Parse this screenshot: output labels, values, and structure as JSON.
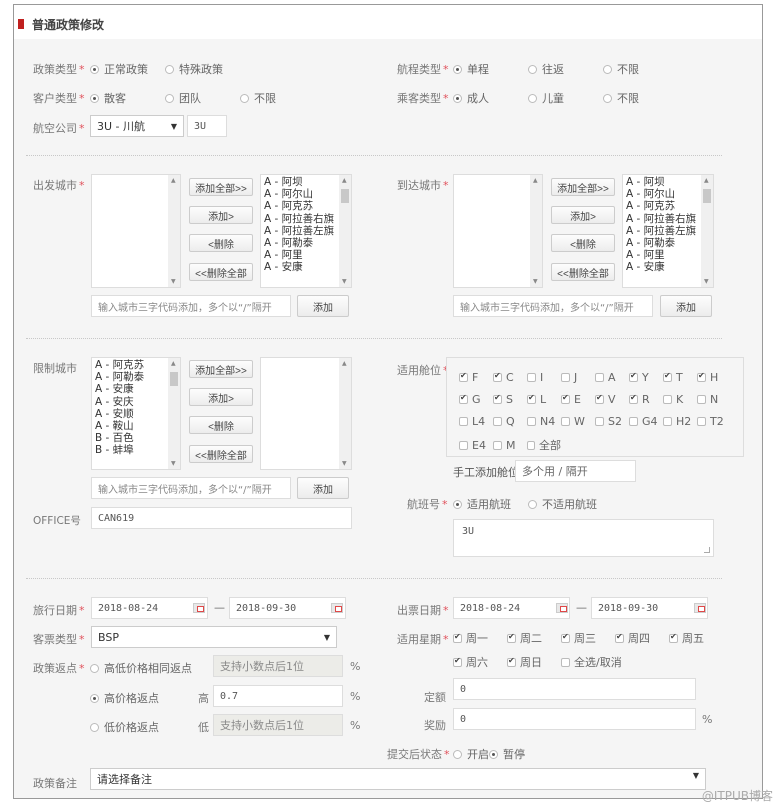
{
  "header": {
    "title": "普通政策修改",
    "accent_color": "#c0201f"
  },
  "policy_type": {
    "label": "政策类型",
    "options": [
      {
        "label": "正常政策",
        "selected": true
      },
      {
        "label": "特殊政策",
        "selected": false
      }
    ]
  },
  "route_type": {
    "label": "航程类型",
    "options": [
      {
        "label": "单程",
        "selected": true
      },
      {
        "label": "往返",
        "selected": false
      },
      {
        "label": "不限",
        "selected": false
      }
    ]
  },
  "customer_type": {
    "label": "客户类型",
    "options": [
      {
        "label": "散客",
        "selected": true
      },
      {
        "label": "团队",
        "selected": false
      },
      {
        "label": "不限",
        "selected": false
      }
    ]
  },
  "passenger_type": {
    "label": "乘客类型",
    "options": [
      {
        "label": "成人",
        "selected": true
      },
      {
        "label": "儿童",
        "selected": false
      },
      {
        "label": "不限",
        "selected": false
      }
    ]
  },
  "airline": {
    "label": "航空公司",
    "selected": "3U - 川航",
    "code": "3U"
  },
  "transfer_buttons": {
    "add_all": "添加全部>>",
    "add": "添加>",
    "remove": "<删除",
    "remove_all": "<<删除全部"
  },
  "city_input": {
    "placeholder": "输入城市三字代码添加，多个以“/”隔开",
    "add_label": "添加"
  },
  "departure_city": {
    "label": "出发城市",
    "selected_items": [],
    "available_items": [
      "A - 阿坝",
      "A - 阿尔山",
      "A - 阿克苏",
      "A - 阿拉善右旗",
      "A - 阿拉善左旗",
      "A - 阿勒泰",
      "A - 阿里",
      "A - 安康"
    ]
  },
  "arrival_city": {
    "label": "到达城市",
    "selected_items": [],
    "available_items": [
      "A - 阿坝",
      "A - 阿尔山",
      "A - 阿克苏",
      "A - 阿拉善右旗",
      "A - 阿拉善左旗",
      "A - 阿勒泰",
      "A - 阿里",
      "A - 安康"
    ]
  },
  "restricted_city": {
    "label": "限制城市",
    "available_items": [
      "A - 阿克苏",
      "A - 阿勒泰",
      "A - 安康",
      "A - 安庆",
      "A - 安顺",
      "A - 鞍山",
      "B - 百色",
      "B - 蚌埠"
    ],
    "selected_items": []
  },
  "office": {
    "label": "OFFICE号",
    "value": "CAN619"
  },
  "cabins": {
    "label": "适用舱位",
    "items": [
      {
        "code": "F",
        "checked": true
      },
      {
        "code": "C",
        "checked": true
      },
      {
        "code": "I",
        "checked": false
      },
      {
        "code": "J",
        "checked": false
      },
      {
        "code": "A",
        "checked": false
      },
      {
        "code": "Y",
        "checked": true
      },
      {
        "code": "T",
        "checked": true
      },
      {
        "code": "H",
        "checked": true
      },
      {
        "code": "G",
        "checked": true
      },
      {
        "code": "S",
        "checked": true
      },
      {
        "code": "L",
        "checked": true
      },
      {
        "code": "E",
        "checked": true
      },
      {
        "code": "V",
        "checked": true
      },
      {
        "code": "R",
        "checked": true
      },
      {
        "code": "K",
        "checked": false
      },
      {
        "code": "N",
        "checked": false
      },
      {
        "code": "L4",
        "checked": false
      },
      {
        "code": "Q",
        "checked": false
      },
      {
        "code": "N4",
        "checked": false
      },
      {
        "code": "W",
        "checked": false
      },
      {
        "code": "S2",
        "checked": false
      },
      {
        "code": "G4",
        "checked": false
      },
      {
        "code": "H2",
        "checked": false
      },
      {
        "code": "T2",
        "checked": false
      },
      {
        "code": "E4",
        "checked": false
      },
      {
        "code": "M",
        "checked": false
      },
      {
        "code": "全部",
        "checked": false
      }
    ],
    "manual_label": "手工添加舱位",
    "manual_placeholder": "多个用 / 隔开"
  },
  "flight_no": {
    "label": "航班号",
    "options": [
      {
        "label": "适用航班",
        "selected": true
      },
      {
        "label": "不适用航班",
        "selected": false
      }
    ],
    "value": "3U"
  },
  "travel_date": {
    "label": "旅行日期",
    "from": "2018-08-24",
    "to": "2018-09-30",
    "separator": "—"
  },
  "ticket_date": {
    "label": "出票日期",
    "from": "2018-08-24",
    "to": "2018-09-30",
    "separator": "—"
  },
  "ticket_type": {
    "label": "客票类型",
    "selected": "BSP"
  },
  "weekdays": {
    "label": "适用星期",
    "items": [
      {
        "label": "周一",
        "checked": true
      },
      {
        "label": "周二",
        "checked": true
      },
      {
        "label": "周三",
        "checked": true
      },
      {
        "label": "周四",
        "checked": true
      },
      {
        "label": "周五",
        "checked": true
      },
      {
        "label": "周六",
        "checked": true
      },
      {
        "label": "周日",
        "checked": true
      },
      {
        "label": "全选/取消",
        "checked": false
      }
    ]
  },
  "rebate": {
    "label": "政策返点",
    "options": [
      {
        "label": "高低价格相同返点",
        "selected": false,
        "prefix": "",
        "placeholder": "支持小数点后1位",
        "value": "",
        "unit": "%"
      },
      {
        "label": "高价格返点",
        "selected": true,
        "prefix": "高",
        "placeholder": "",
        "value": "0.7",
        "unit": "%"
      },
      {
        "label": "低价格返点",
        "selected": false,
        "prefix": "低",
        "placeholder": "支持小数点后1位",
        "value": "",
        "unit": "%"
      }
    ]
  },
  "fixed_amount": {
    "label": "定额",
    "value": "0"
  },
  "bonus": {
    "label": "奖励",
    "value": "0",
    "unit": "%"
  },
  "status_after_submit": {
    "label": "提交后状态",
    "options": [
      {
        "label": "开启",
        "selected": false
      },
      {
        "label": "暂停",
        "selected": true
      }
    ]
  },
  "remark": {
    "label": "政策备注",
    "selected": "请选择备注"
  },
  "watermark": "@ITPUB博客"
}
